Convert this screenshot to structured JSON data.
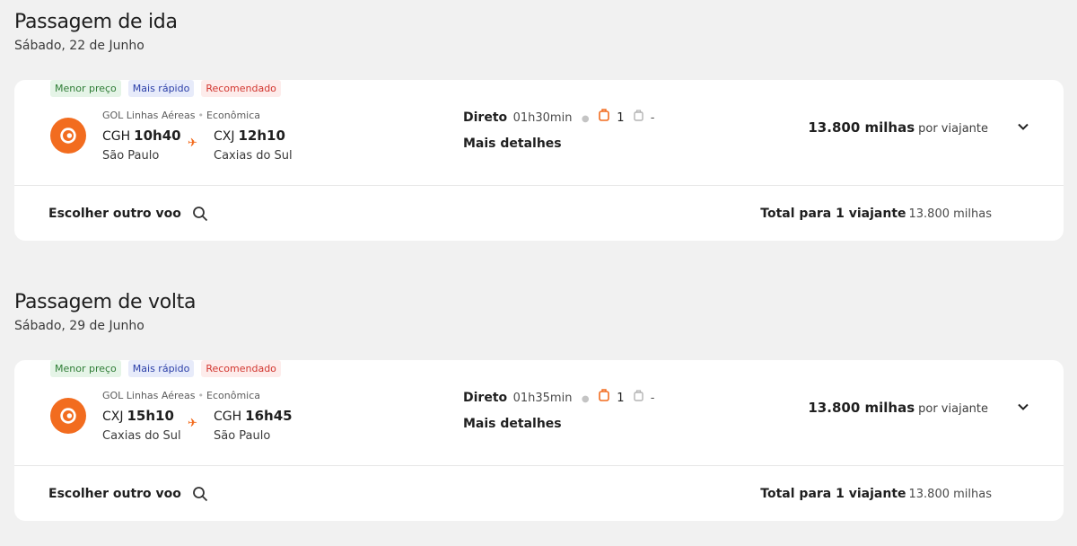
{
  "outbound": {
    "title": "Passagem de ida",
    "date": "Sábado, 22 de Junho",
    "badges": [
      "Menor preço",
      "Mais rápido",
      "Recomendado"
    ],
    "airline": "GOL Linhas Aéreas",
    "cabin": "Econômica",
    "origin_code": "CGH",
    "origin_time": "10h40",
    "origin_city": "São Paulo",
    "dest_code": "CXJ",
    "dest_time": "12h10",
    "dest_city": "Caxias do Sul",
    "type": "Direto",
    "duration": "01h30min",
    "bag_count": "1",
    "other_bag": "-",
    "details": "Mais detalhes",
    "miles": "13.800 milhas",
    "per": "por viajante",
    "other_flight": "Escolher outro voo",
    "total_label": "Total para 1 viajante",
    "total_value": "13.800 milhas"
  },
  "return": {
    "title": "Passagem de volta",
    "date": "Sábado, 29 de Junho",
    "badges": [
      "Menor preço",
      "Mais rápido",
      "Recomendado"
    ],
    "airline": "GOL Linhas Aéreas",
    "cabin": "Econômica",
    "origin_code": "CXJ",
    "origin_time": "15h10",
    "origin_city": "Caxias do Sul",
    "dest_code": "CGH",
    "dest_time": "16h45",
    "dest_city": "São Paulo",
    "type": "Direto",
    "duration": "01h35min",
    "bag_count": "1",
    "other_bag": "-",
    "details": "Mais detalhes",
    "miles": "13.800 milhas",
    "per": "por viajante",
    "other_flight": "Escolher outro voo",
    "total_label": "Total para 1 viajante",
    "total_value": "13.800 milhas"
  },
  "colors": {
    "accent": "#f26c1f",
    "background": "#f1f1f1",
    "card": "#ffffff"
  },
  "icons": {
    "logo": "gol-logo-icon",
    "plane": "airplane-icon",
    "bag": "carry-on-bag-icon",
    "checked_bag": "checked-bag-icon",
    "chevron": "chevron-down-icon",
    "search": "search-icon"
  }
}
